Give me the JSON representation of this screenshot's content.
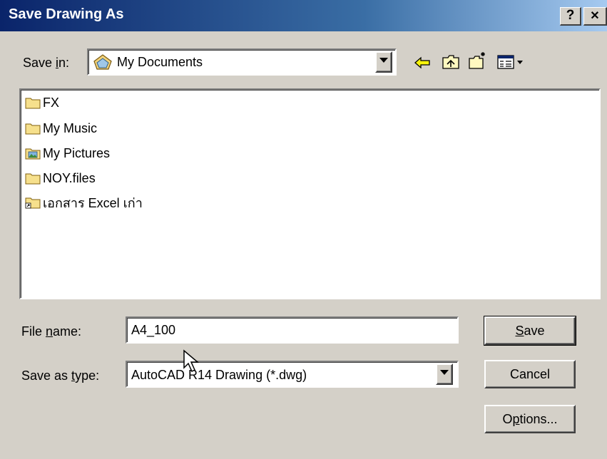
{
  "window": {
    "title": "Save Drawing As",
    "help_label": "?",
    "close_label": "✕"
  },
  "toolbar": {
    "save_in_label": "Save in:",
    "save_in_accel": "i",
    "location": "My Documents",
    "icons": [
      "back-arrow-icon",
      "up-folder-icon",
      "new-folder-icon",
      "view-menu-icon"
    ]
  },
  "files": [
    {
      "name": "FX",
      "icon": "folder-icon"
    },
    {
      "name": "My Music",
      "icon": "folder-icon"
    },
    {
      "name": "My Pictures",
      "icon": "pictures-folder-icon"
    },
    {
      "name": "NOY.files",
      "icon": "folder-icon"
    },
    {
      "name": "เอกสาร Excel เก่า",
      "icon": "folder-shortcut-icon"
    }
  ],
  "form": {
    "file_name_label": "File name:",
    "file_name_value": "A4_100",
    "save_as_type_label": "Save as type:",
    "save_as_type_value": "AutoCAD R14 Drawing (*.dwg)"
  },
  "buttons": {
    "save": "Save",
    "cancel": "Cancel",
    "options": "Options..."
  }
}
